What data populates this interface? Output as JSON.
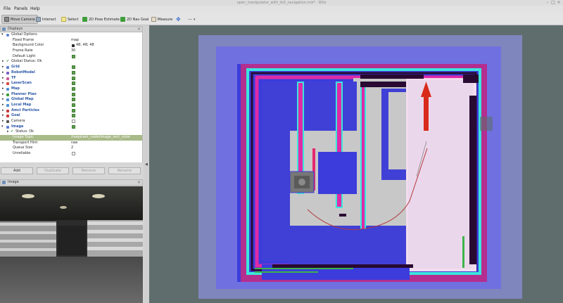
{
  "window": {
    "title": "open_manipulator_with_tb3_navigation.rviz* - RViz"
  },
  "menu": {
    "file": "File",
    "panels": "Panels",
    "help": "Help"
  },
  "toolbar": {
    "move_camera": "Move Camera",
    "interact": "Interact",
    "select": "Select",
    "pose_estimate": "2D Pose Estimate",
    "nav_goal": "2D Nav Goal",
    "measure": "Measure"
  },
  "displays_panel": {
    "title": "Displays",
    "rows": [
      {
        "label": "Global Options",
        "kind": "group",
        "value": ""
      },
      {
        "label": "Fixed Frame",
        "kind": "prop",
        "value": "map"
      },
      {
        "label": "Background Color",
        "kind": "prop",
        "value": "48; 48; 48"
      },
      {
        "label": "Frame Rate",
        "kind": "prop",
        "value": "30"
      },
      {
        "label": "Default Light",
        "kind": "prop",
        "value": ""
      },
      {
        "label": "Global Status: Ok",
        "kind": "status",
        "value": ""
      },
      {
        "label": "Grid",
        "kind": "display",
        "value": ""
      },
      {
        "label": "RobotModel",
        "kind": "display",
        "value": ""
      },
      {
        "label": "TF",
        "kind": "display",
        "value": ""
      },
      {
        "label": "LaserScan",
        "kind": "display",
        "value": ""
      },
      {
        "label": "Map",
        "kind": "display",
        "value": ""
      },
      {
        "label": "Planner Plan",
        "kind": "display",
        "value": ""
      },
      {
        "label": "Global Map",
        "kind": "display",
        "value": ""
      },
      {
        "label": "Local Map",
        "kind": "display",
        "value": ""
      },
      {
        "label": "Amcl Particles",
        "kind": "display",
        "value": ""
      },
      {
        "label": "Goal",
        "kind": "display",
        "value": ""
      },
      {
        "label": "Camera",
        "kind": "display",
        "value": ""
      },
      {
        "label": "Image",
        "kind": "display",
        "value": ""
      },
      {
        "label": "Status: Ok",
        "kind": "substatus",
        "value": ""
      },
      {
        "label": "Image Topic",
        "kind": "subprop",
        "value": "/raspicam_node/image_rect_color"
      },
      {
        "label": "Transport Hint",
        "kind": "subprop",
        "value": "raw"
      },
      {
        "label": "Queue Size",
        "kind": "subprop",
        "value": "2"
      },
      {
        "label": "Unreliable",
        "kind": "subprop",
        "value": ""
      }
    ],
    "buttons": {
      "add": "Add",
      "duplicate": "Duplicate",
      "remove": "Remove",
      "rename": "Rename"
    }
  },
  "image_panel": {
    "title": "Image"
  },
  "colors": {
    "map_free": "#dcdcdc",
    "map_background": "#5f6d6d",
    "costmap_low": "#3c3cdc",
    "costmap_high": "#e6286e",
    "inflation": "#3ce6dc",
    "obstacle": "#280a32",
    "goal_arrow": "#d82a1a",
    "particles": "#3cb44b"
  }
}
